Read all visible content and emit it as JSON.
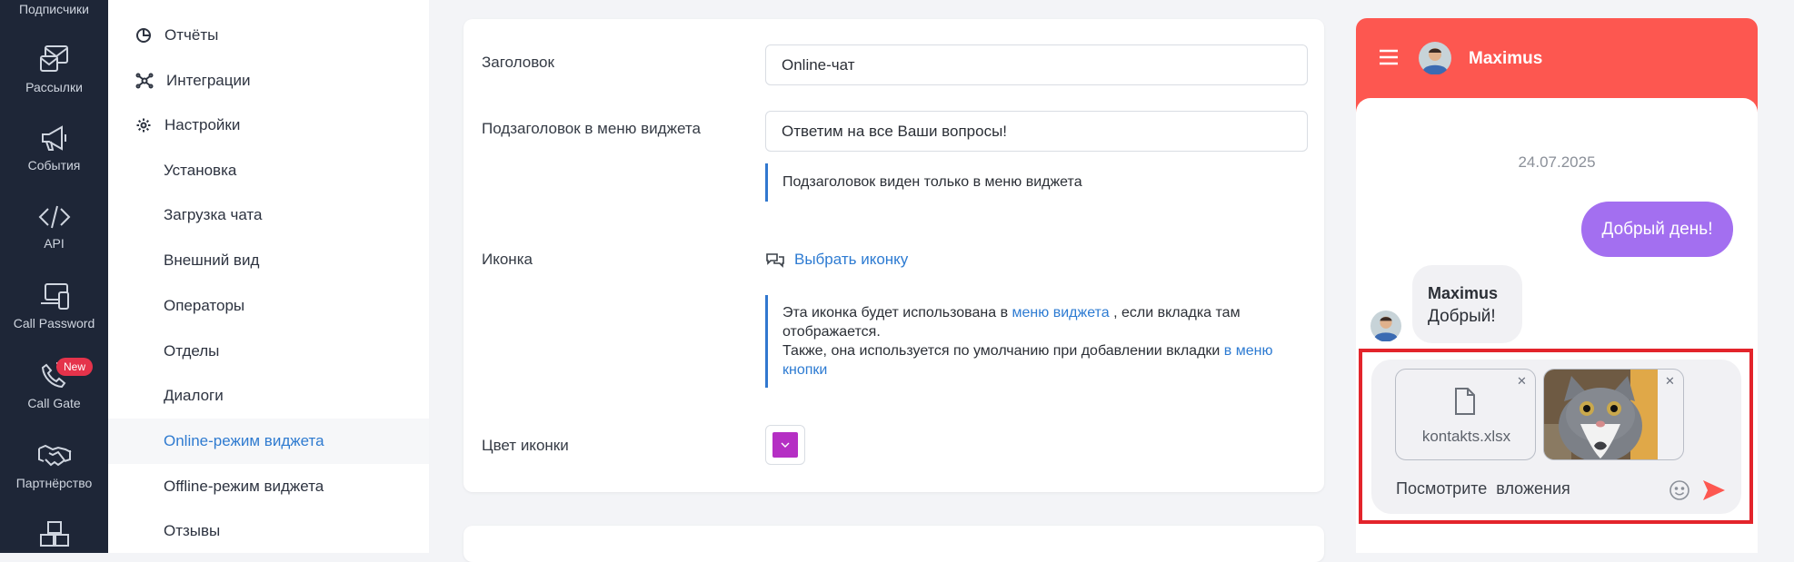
{
  "rail": {
    "items": [
      {
        "label": "Подписчики",
        "icon": "subscribers-icon"
      },
      {
        "label": "Рассылки",
        "icon": "mailing-icon"
      },
      {
        "label": "События",
        "icon": "megaphone-icon"
      },
      {
        "label": "API",
        "icon": "code-icon"
      },
      {
        "label": "Call Password",
        "icon": "devices-icon"
      },
      {
        "label": "Call Gate",
        "icon": "phone-icon",
        "badge": "New"
      },
      {
        "label": "Партнёрство",
        "icon": "handshake-icon"
      },
      {
        "label": "",
        "icon": "boxes-icon"
      }
    ]
  },
  "subnav": {
    "top": [
      {
        "label": "Отчёты",
        "icon": "pie-chart-icon"
      },
      {
        "label": "Интеграции",
        "icon": "integrations-icon"
      },
      {
        "label": "Настройки",
        "icon": "gear-icon"
      }
    ],
    "sub": [
      "Установка",
      "Загрузка чата",
      "Внешний вид",
      "Операторы",
      "Отделы",
      "Диалоги",
      "Online-режим виджета",
      "Offline-режим виджета",
      "Отзывы"
    ],
    "active": "Online-режим виджета"
  },
  "form": {
    "title_label": "Заголовок",
    "title_value": "Online-чат",
    "subtitle_label": "Подзаголовок в меню виджета",
    "subtitle_value": "Ответим на все Ваши вопросы!",
    "subtitle_hint": "Подзаголовок виден только в меню виджета",
    "icon_label": "Иконка",
    "icon_link": "Выбрать иконку",
    "icon_hint_1": "Эта иконка будет использована в",
    "icon_hint_link_1": "меню виджета",
    "icon_hint_2": ", если вкладка там отображается.",
    "icon_hint_3": "Также, она используется по умолчанию при добавлении вкладки",
    "icon_hint_link_2": "в меню кнопки",
    "color_label": "Цвет иконки",
    "color_value": "#b52fc4"
  },
  "chat": {
    "operator_name": "Maximus",
    "accent": "#fd5750",
    "date": "24.07.2025",
    "outgoing_message": "Добрый день!",
    "outgoing_color": "#a36ff0",
    "incoming_name": "Maximus",
    "incoming_message": "Добрый!",
    "attachments": [
      {
        "type": "file",
        "name": "kontakts.xlsx"
      },
      {
        "type": "image",
        "description": "cat-photo"
      }
    ],
    "composer_text": "Посмотрите  вложения"
  }
}
